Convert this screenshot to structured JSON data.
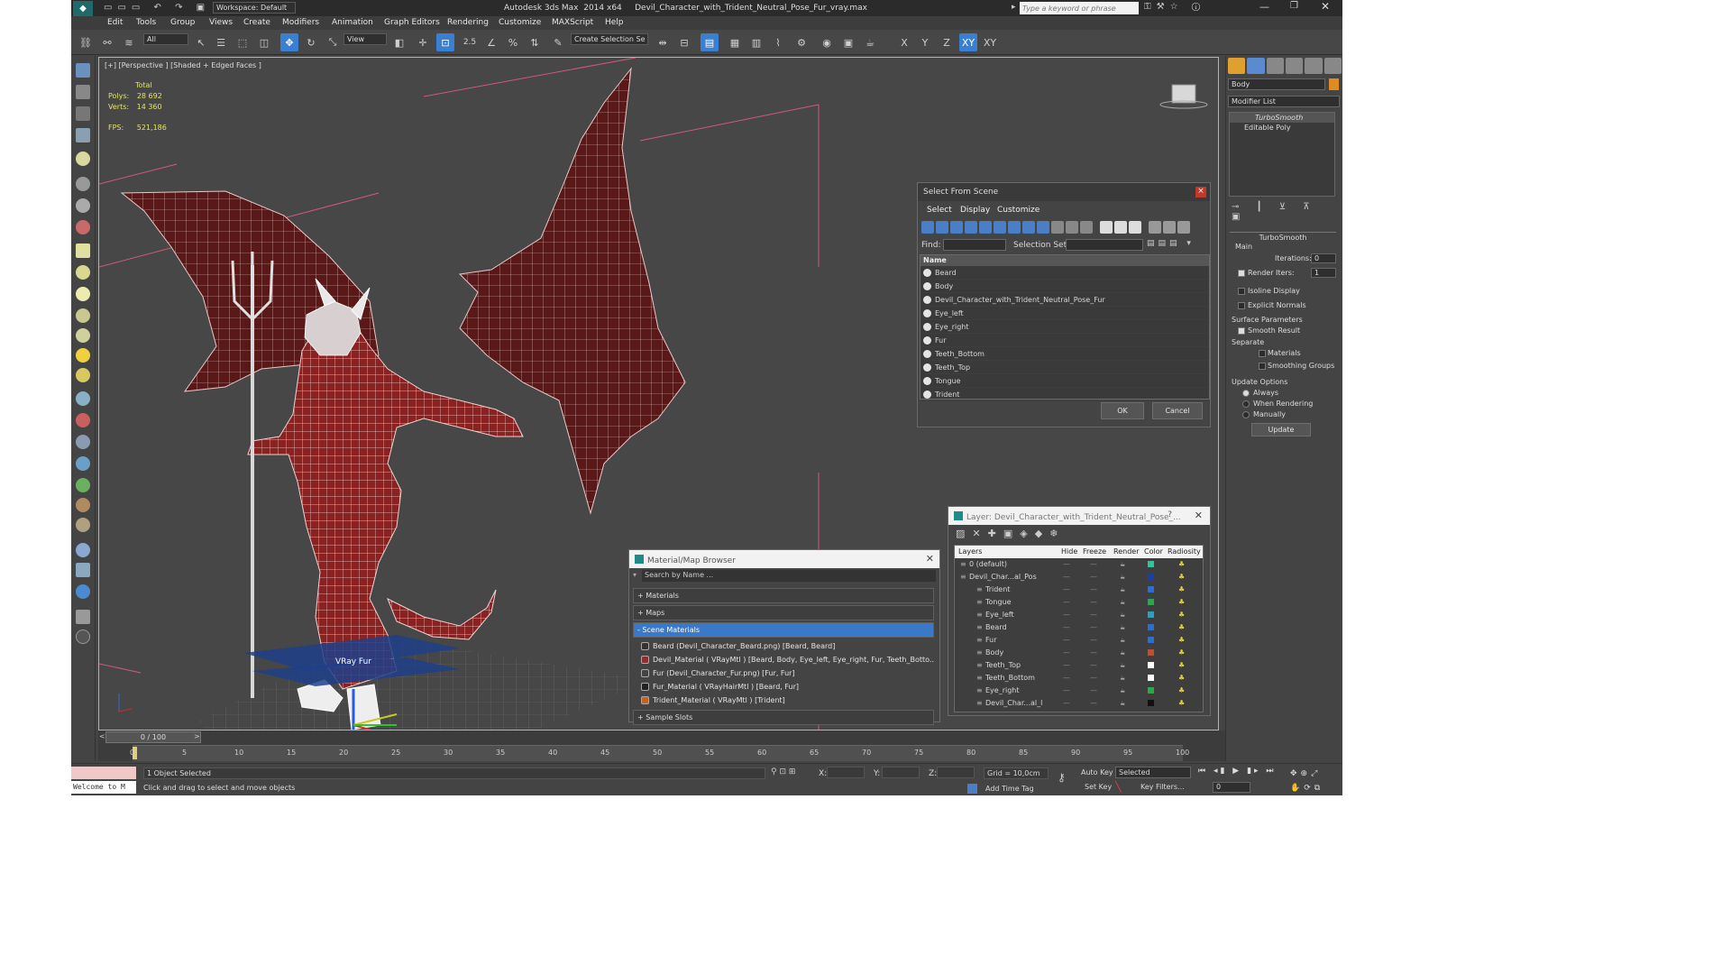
{
  "app": {
    "title": "Autodesk 3ds Max  2014 x64     Devil_Character_with_Trident_Neutral_Pose_Fur_vray.max",
    "workspace": "Workspace: Default",
    "search_placeholder": "Type a keyword or phrase"
  },
  "menu": [
    "Edit",
    "Tools",
    "Group",
    "Views",
    "Create",
    "Modifiers",
    "Animation",
    "Graph Editors",
    "Rendering",
    "Customize",
    "MAXScript",
    "Help"
  ],
  "toolbar": {
    "filter": "All",
    "ref_coord": "View",
    "create_selection_set": "Create Selection Se",
    "axes": [
      "X",
      "Y",
      "Z",
      "XY"
    ],
    "snap_label": "2.5"
  },
  "viewport": {
    "label": "[+] [Perspective ] [Shaded + Edged Faces ]",
    "stats_total": "Total",
    "polys_label": "Polys:",
    "polys_value": "28 692",
    "verts_label": "Verts:",
    "verts_value": "14 360",
    "fps_label": "FPS:",
    "fps_value": "521,186",
    "vrayfur_label": "VRay Fur"
  },
  "select_from_scene": {
    "title": "Select From Scene",
    "tabs": [
      "Select",
      "Display",
      "Customize"
    ],
    "find_label": "Find:",
    "selection_set_label": "Selection Set:",
    "column_name": "Name",
    "items": [
      "Beard",
      "Body",
      "Devil_Character_with_Trident_Neutral_Pose_Fur",
      "Eye_left",
      "Eye_right",
      "Fur",
      "Teeth_Bottom",
      "Teeth_Top",
      "Tongue",
      "Trident"
    ],
    "ok": "OK",
    "cancel": "Cancel"
  },
  "material_browser": {
    "title": "Material/Map Browser",
    "search_placeholder": "Search by Name ...",
    "groups": [
      "+ Materials",
      "+ Maps",
      "- Scene Materials"
    ],
    "scene_materials": [
      "Beard (Devil_Character_Beard.png) [Beard, Beard]",
      "Devil_Material  ( VRayMtl ) [Beard, Body, Eye_left, Eye_right, Fur, Teeth_Botto...",
      "Fur (Devil_Character_Fur.png) [Fur, Fur]",
      "Fur_Material  ( VRayHairMtl ) [Beard, Fur]",
      "Trident_Material  ( VRayMtl ) [Trident]"
    ],
    "sample_slots": "+ Sample Slots"
  },
  "layer_explorer": {
    "title": "Layer: Devil_Character_with_Trident_Neutral_Pose_...",
    "help": "?",
    "columns": [
      "Layers",
      "Hide",
      "Freeze",
      "Render",
      "Color",
      "Radiosity"
    ],
    "rows": [
      {
        "name": "0 (default)",
        "color": "#2ec4a0",
        "indent": 1
      },
      {
        "name": "Devil_Char...al_Pos",
        "color": "#1a3fa8",
        "indent": 1
      },
      {
        "name": "Trident",
        "color": "#2a6fd0",
        "indent": 2
      },
      {
        "name": "Tongue",
        "color": "#2aa84a",
        "indent": 2
      },
      {
        "name": "Eye_left",
        "color": "#2a9fc0",
        "indent": 2
      },
      {
        "name": "Beard",
        "color": "#2a6fd0",
        "indent": 2
      },
      {
        "name": "Fur",
        "color": "#2a6fd0",
        "indent": 2
      },
      {
        "name": "Body",
        "color": "#c0502a",
        "indent": 2
      },
      {
        "name": "Teeth_Top",
        "color": "#ffffff",
        "indent": 2
      },
      {
        "name": "Teeth_Bottom",
        "color": "#ffffff",
        "indent": 2
      },
      {
        "name": "Eye_right",
        "color": "#2aa84a",
        "indent": 2
      },
      {
        "name": "Devil_Char...al_l",
        "color": "#111111",
        "indent": 2
      }
    ]
  },
  "command_panel": {
    "object_name": "Body",
    "modifier_list": "Modifier List",
    "stack": [
      "TurboSmooth",
      "Editable Poly"
    ],
    "rollout_title": "TurboSmooth",
    "main": "Main",
    "iterations_label": "Iterations:",
    "iterations_value": "0",
    "render_iters_label": "Render Iters:",
    "render_iters_value": "1",
    "isoline": "Isoline Display",
    "explicit_normals": "Explicit Normals",
    "surface_params": "Surface Parameters",
    "smooth_result": "Smooth Result",
    "separate": "Separate",
    "materials": "Materials",
    "smoothing_groups": "Smoothing Groups",
    "update_options": "Update Options",
    "always": "Always",
    "when_rendering": "When Rendering",
    "manually": "Manually",
    "update": "Update"
  },
  "timeline": {
    "frame": "0 / 100",
    "ticks": [
      "0",
      "5",
      "10",
      "15",
      "20",
      "25",
      "30",
      "35",
      "40",
      "45",
      "50",
      "55",
      "60",
      "65",
      "70",
      "75",
      "80",
      "85",
      "90",
      "95",
      "100"
    ]
  },
  "status": {
    "script_listener": "Welcome to M",
    "selected": "1 Object Selected",
    "prompt": "Click and drag to select and move objects",
    "x_label": "X:",
    "y_label": "Y:",
    "z_label": "Z:",
    "grid": "Grid = 10,0cm",
    "add_time_tag": "Add Time Tag",
    "auto_key": "Auto Key",
    "selected_dd": "Selected",
    "set_key": "Set Key",
    "key_filters": "Key Filters...",
    "frame_field": "0"
  }
}
